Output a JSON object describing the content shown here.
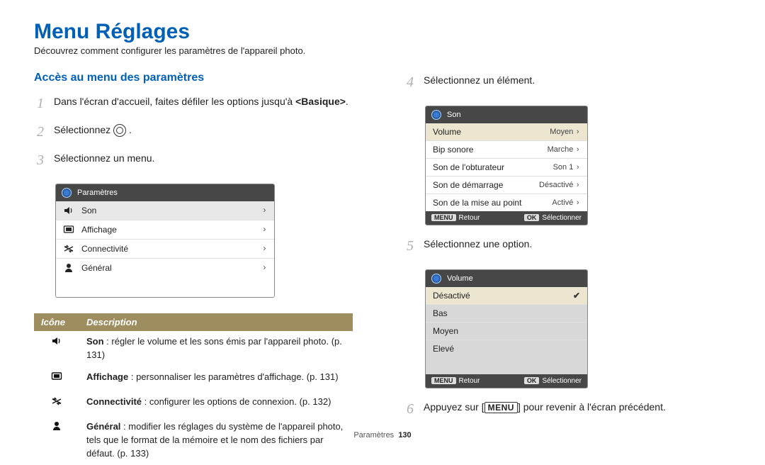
{
  "page_title": "Menu Réglages",
  "subtitle": "Découvrez comment configurer les paramètres de l'appareil photo.",
  "section_title": "Accès au menu des paramètres",
  "steps": {
    "s1_pre": "Dans l'écran d'accueil, faites défiler les options jusqu'à ",
    "s1_bold": "<Basique>",
    "s1_post": ".",
    "s2_pre": "Sélectionnez ",
    "s2_post": ".",
    "s3": "Sélectionnez un menu.",
    "s4": "Sélectionnez un élément.",
    "s5": "Sélectionnez une option.",
    "s6_pre": "Appuyez sur [",
    "s6_menu": "MENU",
    "s6_post": "] pour revenir à l'écran précédent."
  },
  "panel1": {
    "title": "Paramètres",
    "rows": [
      {
        "label": "Son"
      },
      {
        "label": "Affichage"
      },
      {
        "label": "Connectivité"
      },
      {
        "label": "Général"
      }
    ]
  },
  "panel2": {
    "title": "Son",
    "rows": [
      {
        "label": "Volume",
        "value": "Moyen"
      },
      {
        "label": "Bip sonore",
        "value": "Marche"
      },
      {
        "label": "Son de l'obturateur",
        "value": "Son 1"
      },
      {
        "label": "Son de démarrage",
        "value": "Désactivé"
      },
      {
        "label": "Son de la mise au point",
        "value": "Activé"
      }
    ],
    "footer_back": "Retour",
    "footer_select": "Sélectionner",
    "menu_label": "MENU",
    "ok_label": "OK"
  },
  "panel3": {
    "title": "Volume",
    "options": [
      "Désactivé",
      "Bas",
      "Moyen",
      "Elevé"
    ],
    "selected_index": 0,
    "footer_back": "Retour",
    "footer_select": "Sélectionner",
    "menu_label": "MENU",
    "ok_label": "OK"
  },
  "table": {
    "h1": "Icône",
    "h2": "Description",
    "rows": [
      {
        "bold": "Son",
        "rest": " : régler le volume et les sons émis par l'appareil photo. (p. 131)"
      },
      {
        "bold": "Affichage",
        "rest": " : personnaliser les paramètres d'affichage. (p. 131)"
      },
      {
        "bold": "Connectivité",
        "rest": " : configurer les options de connexion. (p. 132)"
      },
      {
        "bold": "Général",
        "rest": " : modifier les réglages du système de l'appareil photo, tels que le format de la mémoire et le nom des fichiers par défaut. (p. 133)"
      }
    ]
  },
  "footer": {
    "section": "Paramètres",
    "page": "130"
  }
}
